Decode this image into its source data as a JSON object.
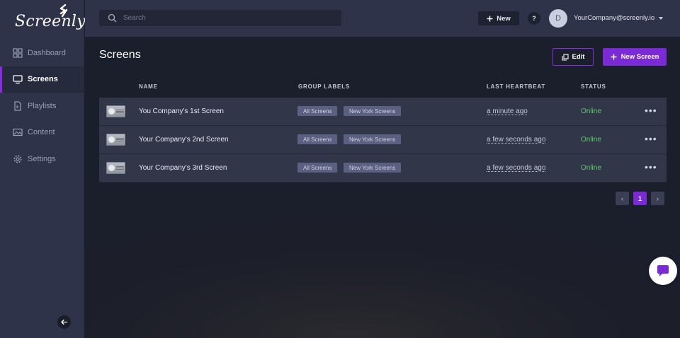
{
  "app": {
    "logo_text": "Screenly"
  },
  "sidebar": {
    "items": [
      {
        "label": "Dashboard",
        "icon": "grid-icon",
        "active": false
      },
      {
        "label": "Screens",
        "icon": "monitor-icon",
        "active": true
      },
      {
        "label": "Playlists",
        "icon": "file-icon",
        "active": false
      },
      {
        "label": "Content",
        "icon": "image-icon",
        "active": false
      },
      {
        "label": "Settings",
        "icon": "gear-icon",
        "active": false
      }
    ],
    "collapse_icon": "arrow-left-icon"
  },
  "topbar": {
    "search_placeholder": "Search",
    "new_label": "New",
    "help_label": "?",
    "avatar_initial": "D",
    "account_email": "YourCompany@screenly.io"
  },
  "main": {
    "title": "Screens",
    "edit_label": "Edit",
    "new_screen_label": "New Screen"
  },
  "table": {
    "headers": {
      "name": "NAME",
      "labels": "GROUP LABELS",
      "heartbeat": "LAST HEARTBEAT",
      "status": "STATUS"
    },
    "rows": [
      {
        "name": "You Company's 1st Screen",
        "labels": [
          "All Screens",
          "New York Screens"
        ],
        "heartbeat": "a minute ago",
        "status": "Online"
      },
      {
        "name": "Your Company's 2nd Screen",
        "labels": [
          "All Screens",
          "New York Screens"
        ],
        "heartbeat": "a few seconds ago",
        "status": "Online"
      },
      {
        "name": "Your Company's 3rd Screen",
        "labels": [
          "All Screens",
          "New York Screens"
        ],
        "heartbeat": "a few seconds ago",
        "status": "Online"
      }
    ],
    "more_glyph": "•••"
  },
  "pagination": {
    "prev": "‹",
    "current": "1",
    "next": "›"
  },
  "colors": {
    "accent": "#7b2bd6",
    "online": "#5fcb6b",
    "sidebar": "#2f3349",
    "background": "#1c1f2c"
  }
}
